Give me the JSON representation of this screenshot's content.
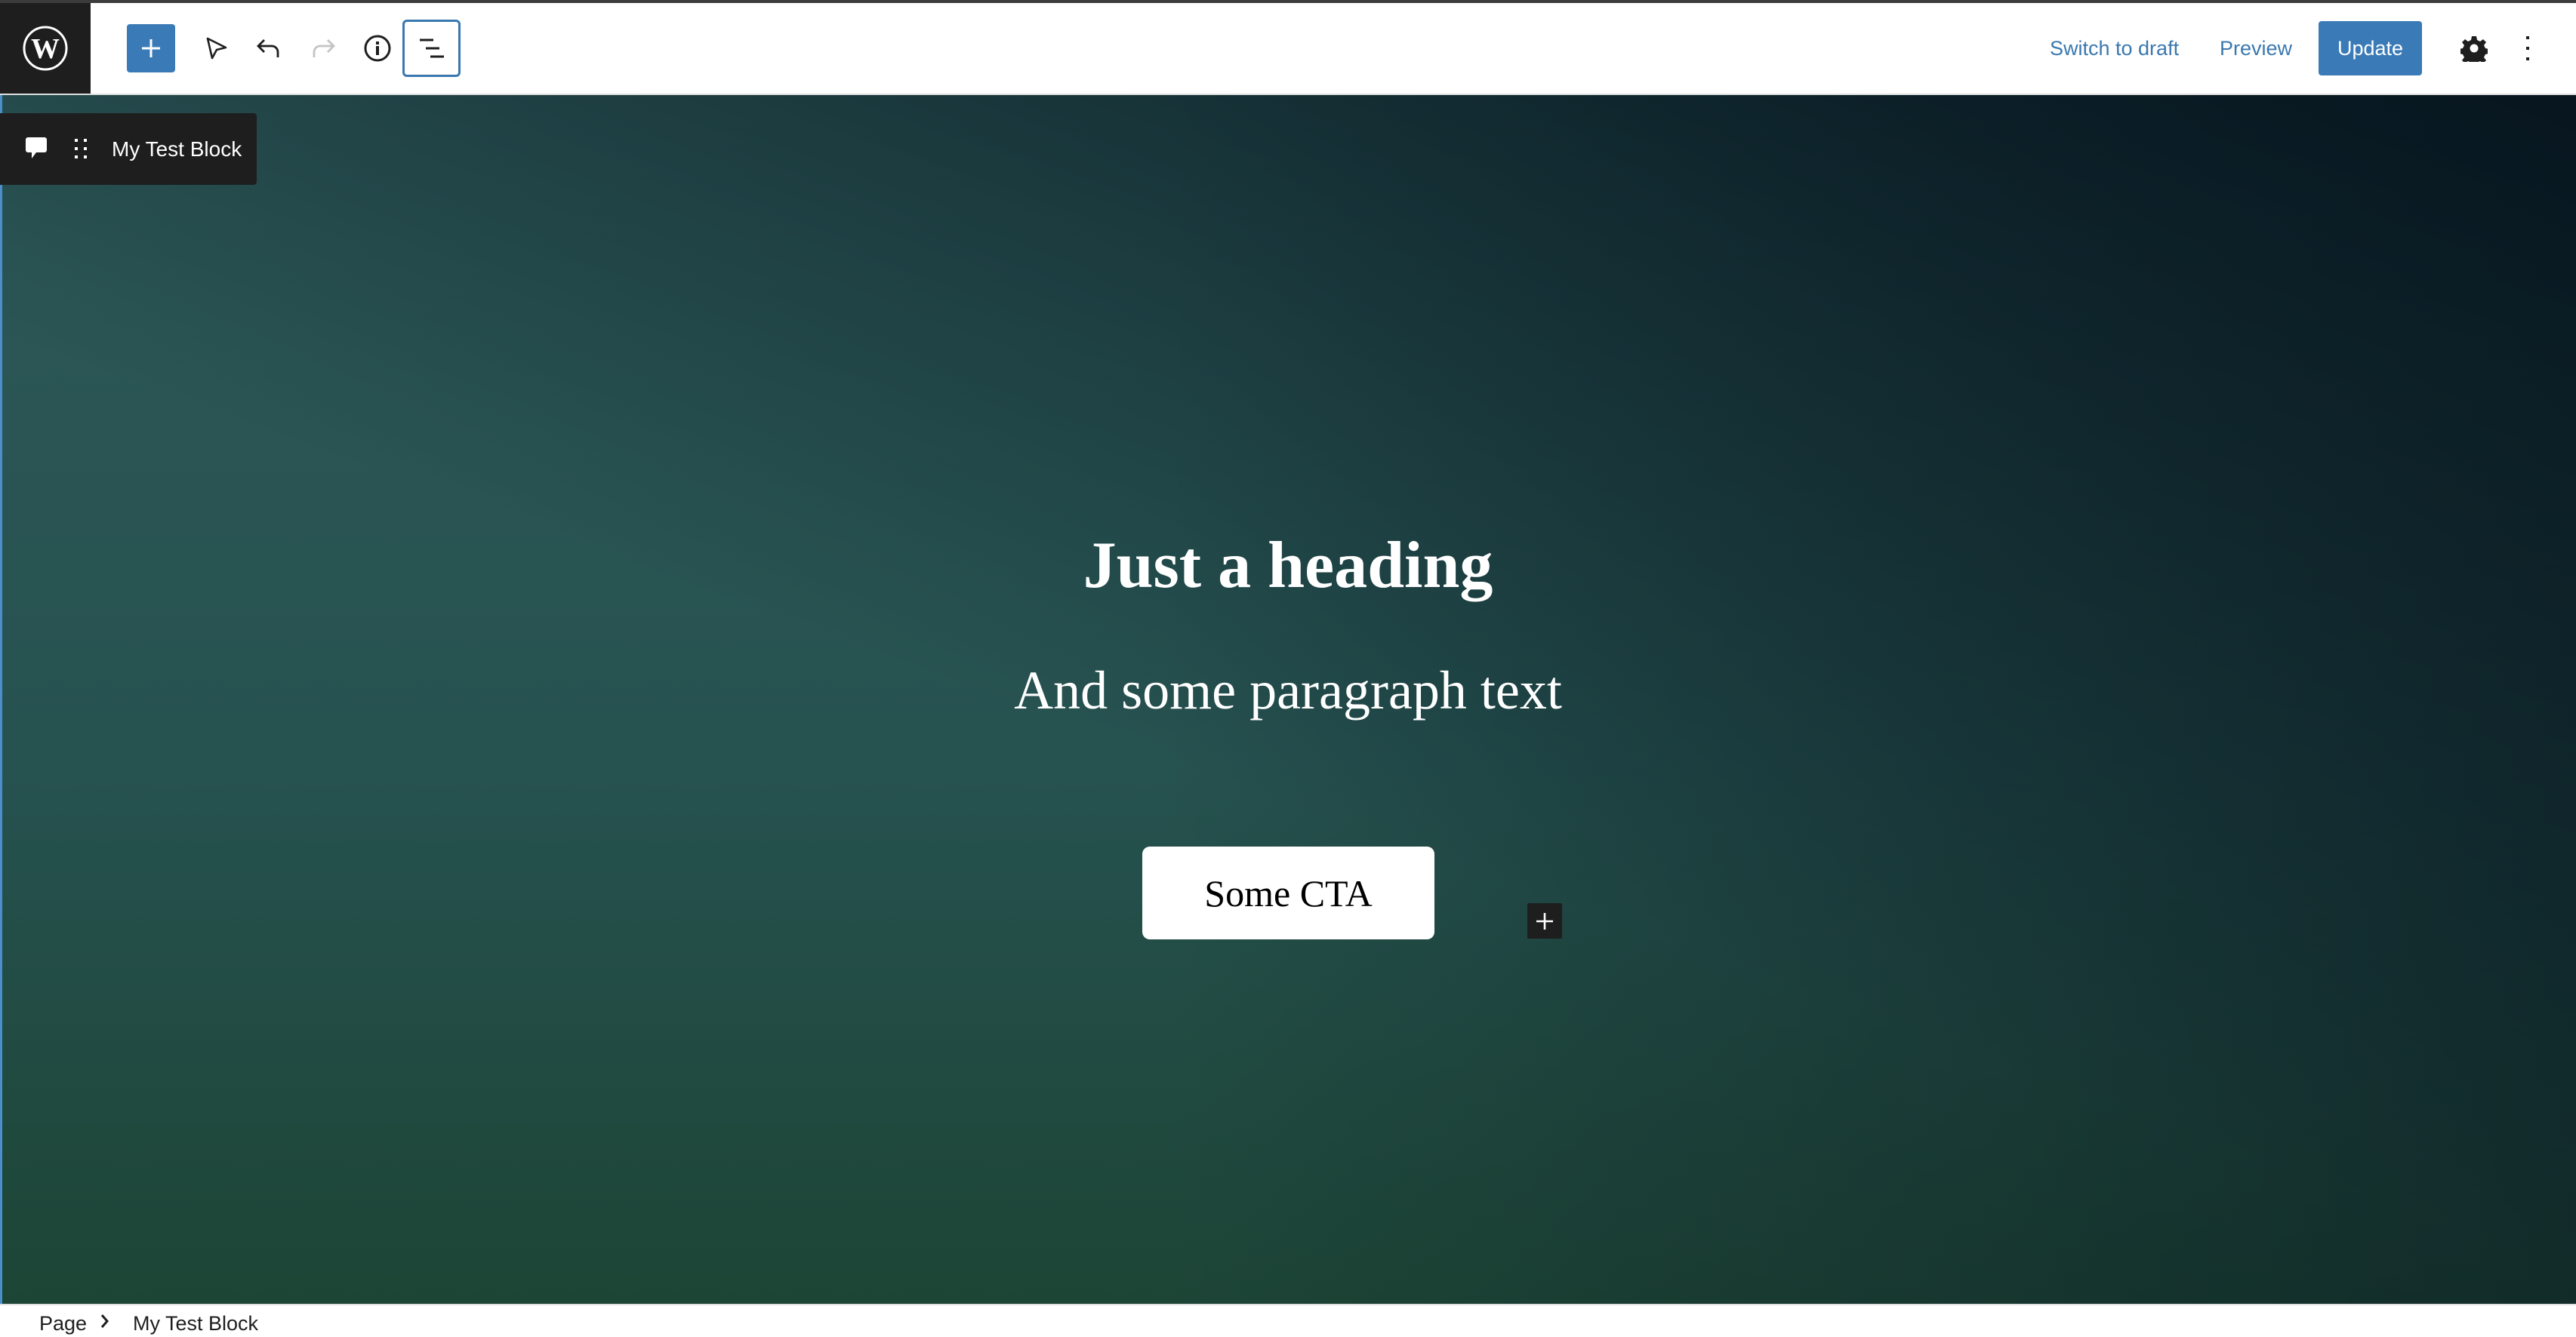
{
  "header": {
    "logo": "wordpress-logo",
    "tools": [
      {
        "name": "add-block",
        "icon": "plus-icon"
      },
      {
        "name": "select-tool",
        "icon": "cursor-icon"
      },
      {
        "name": "undo",
        "icon": "undo-icon"
      },
      {
        "name": "redo",
        "icon": "redo-icon",
        "disabled": true
      },
      {
        "name": "details",
        "icon": "info-icon"
      },
      {
        "name": "list-view",
        "icon": "list-view-icon",
        "active": true
      }
    ],
    "switch_to_draft_label": "Switch to draft",
    "preview_label": "Preview",
    "update_label": "Update",
    "settings_icon": "gear-icon",
    "more_icon": "more-vertical-icon"
  },
  "block_toolbar": {
    "parent_icon": "comment-icon",
    "drag_icon": "drag-handle-icon",
    "block_name": "My Test Block"
  },
  "canvas": {
    "heading": "Just a heading",
    "paragraph": "And some paragraph text",
    "cta_label": "Some CTA",
    "gradient_colors": [
      "#2e5858",
      "#1d4536",
      "#061520",
      "#112a2e"
    ]
  },
  "footer": {
    "breadcrumbs": [
      "Page",
      "My Test Block"
    ]
  },
  "colors": {
    "accent": "#3a7ab6",
    "link": "#3a78b0",
    "dark": "#1e1e1e"
  }
}
